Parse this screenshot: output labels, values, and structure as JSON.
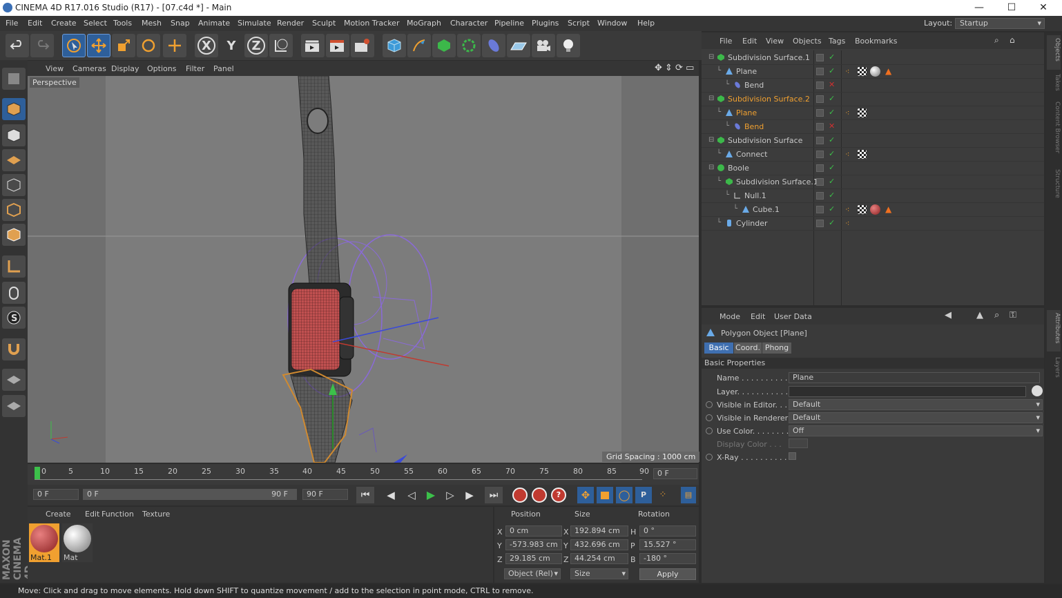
{
  "titlebar": {
    "title": "CINEMA 4D R17.016 Studio (R17) - [07.c4d *] - Main",
    "minimize": "—",
    "maximize": "☐",
    "close": "✕"
  },
  "menubar": {
    "items": [
      "File",
      "Edit",
      "Create",
      "Select",
      "Tools",
      "Mesh",
      "Snap",
      "Animate",
      "Simulate",
      "Render",
      "Sculpt",
      "Motion Tracker",
      "MoGraph",
      "Character",
      "Pipeline",
      "Plugins",
      "Script",
      "Window",
      "Help"
    ],
    "layout_label": "Layout:",
    "layout_value": "Startup"
  },
  "toolbar": {
    "x_label": "X",
    "y_label": "Y",
    "z_label": "Z"
  },
  "viewport": {
    "menu": [
      "View",
      "Cameras",
      "Display",
      "Options",
      "Filter",
      "Panel"
    ],
    "label": "Perspective",
    "grid_spacing": "Grid Spacing : 1000 cm"
  },
  "timeline": {
    "ticks": [
      "0",
      "5",
      "10",
      "15",
      "20",
      "25",
      "30",
      "35",
      "40",
      "45",
      "50",
      "55",
      "60",
      "65",
      "70",
      "75",
      "80",
      "85",
      "90"
    ],
    "current_frame": "0 F"
  },
  "transport": {
    "start": "0 F",
    "range_start": "0 F",
    "range_end": "90 F",
    "end": "90 F"
  },
  "materials": {
    "menu": [
      "Create",
      "Edit",
      "Function",
      "Texture"
    ],
    "items": [
      {
        "name": "Mat.1",
        "color": "#b53c3c"
      },
      {
        "name": "Mat",
        "color": "#c8c8c8"
      }
    ]
  },
  "coords": {
    "headers": [
      "Position",
      "Size",
      "Rotation"
    ],
    "rows": [
      {
        "axis": "X",
        "pos": "0 cm",
        "size_axis": "X",
        "size": "192.894 cm",
        "rot_axis": "H",
        "rot": "0 °"
      },
      {
        "axis": "Y",
        "pos": "-573.983 cm",
        "size_axis": "Y",
        "size": "432.696 cm",
        "rot_axis": "P",
        "rot": "15.527 °"
      },
      {
        "axis": "Z",
        "pos": "29.185 cm",
        "size_axis": "Z",
        "size": "44.254 cm",
        "rot_axis": "B",
        "rot": "-180 °"
      }
    ],
    "mode": "Object (Rel)",
    "size_mode": "Size",
    "apply": "Apply"
  },
  "objects": {
    "menu": [
      "File",
      "Edit",
      "View",
      "Objects",
      "Tags",
      "Bookmarks"
    ],
    "rows": [
      {
        "name": "Subdivision Surface.1",
        "indent": 0,
        "selected": false,
        "icon": "subdivision-icon"
      },
      {
        "name": "Plane",
        "indent": 1,
        "selected": false,
        "icon": "plane-icon"
      },
      {
        "name": "Bend",
        "indent": 2,
        "selected": false,
        "icon": "bend-icon"
      },
      {
        "name": "Subdivision Surface.2",
        "indent": 0,
        "selected": true,
        "icon": "subdivision-icon"
      },
      {
        "name": "Plane",
        "indent": 1,
        "selected": true,
        "icon": "plane-icon"
      },
      {
        "name": "Bend",
        "indent": 2,
        "selected": true,
        "icon": "bend-icon"
      },
      {
        "name": "Subdivision Surface",
        "indent": 0,
        "selected": false,
        "icon": "subdivision-icon"
      },
      {
        "name": "Connect",
        "indent": 1,
        "selected": false,
        "icon": "connect-icon"
      },
      {
        "name": "Boole",
        "indent": 0,
        "selected": false,
        "icon": "boole-icon"
      },
      {
        "name": "Subdivision Surface.1",
        "indent": 1,
        "selected": false,
        "icon": "subdivision-icon"
      },
      {
        "name": "Null.1",
        "indent": 2,
        "selected": false,
        "icon": "null-icon"
      },
      {
        "name": "Cube.1",
        "indent": 3,
        "selected": false,
        "icon": "cube-icon"
      },
      {
        "name": "Cylinder",
        "indent": 1,
        "selected": false,
        "icon": "cylinder-icon"
      }
    ]
  },
  "attributes": {
    "menu": [
      "Mode",
      "Edit",
      "User Data"
    ],
    "object_title": "Polygon Object [Plane]",
    "tabs": [
      "Basic",
      "Coord.",
      "Phong"
    ],
    "section": "Basic Properties",
    "fields": [
      {
        "label": "Name . . . . . . . . . . .",
        "value": "Plane"
      },
      {
        "label": "Layer. . . . . . . . . . .",
        "value": ""
      },
      {
        "label": "Visible in Editor. . .",
        "value": "Default"
      },
      {
        "label": "Visible in Renderer",
        "value": "Default"
      },
      {
        "label": "Use Color. . . . . . . .",
        "value": "Off"
      },
      {
        "label": "Display Color . . .",
        "value": ""
      },
      {
        "label": "X-Ray . . . . . . . . . .",
        "value": ""
      }
    ]
  },
  "rightstrip": [
    "Objects",
    "Takes",
    "Content Browser",
    "Structure",
    "Attributes",
    "Layers"
  ],
  "statusbar": {
    "text": "Move: Click and drag to move elements. Hold down SHIFT to quantize movement / add to the selection in point mode, CTRL to remove."
  },
  "branding": {
    "logo_text": "MAXON CINEMA 4D"
  },
  "colors": {
    "accent_orange": "#f0a030",
    "selected_text": "#f0a030",
    "accent_blue": "#3f6fb0"
  }
}
